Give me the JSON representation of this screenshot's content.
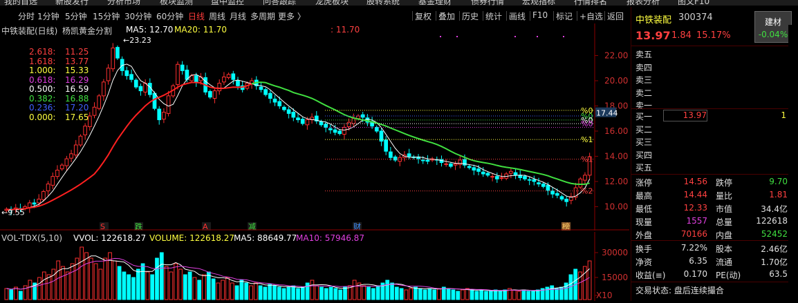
{
  "top_menu": [
    "我的首选",
    "新股发行",
    "分析市场",
    "板块监测",
    "盘中监控",
    "问答跟踪",
    "龙虎板块",
    "股转系统",
    "基金理财",
    "债券行情",
    "宏观指标",
    "行情排名",
    "报表分析",
    "图文F10"
  ],
  "toolbar": {
    "left": [
      "分时",
      "1分钟",
      "5分钟",
      "15分钟",
      "30分钟",
      "60分钟",
      "日线",
      "周线",
      "月线",
      "多周期",
      "更多 〉"
    ],
    "active": "日线",
    "right": [
      "复权",
      "叠加",
      "历史",
      "统计",
      "画线",
      "F10",
      "标记",
      "+自选",
      "返回"
    ]
  },
  "chart_header": {
    "title": "中铁装配(日线)",
    "indicator": "杨凯黄金分割",
    "ma5": "MA5: 12.70",
    "ma20": "MA20: 11.70",
    "ma_marker": ": 11.70"
  },
  "golden_ratios": [
    {
      "label": "2.618:",
      "value": "11.25",
      "color": "#ff4040"
    },
    {
      "label": "1.618:",
      "value": "13.77",
      "color": "#ff4040"
    },
    {
      "label": "1.000:",
      "value": "15.33",
      "color": "#ffff40"
    },
    {
      "label": "0.618:",
      "value": "16.29",
      "color": "#e040e0"
    },
    {
      "label": "0.500:",
      "value": "16.59",
      "color": "#ffffff"
    },
    {
      "label": "0.382:",
      "value": "16.88",
      "color": "#40e040"
    },
    {
      "label": "0.236:",
      "value": "17.20",
      "color": "#4060ff"
    },
    {
      "label": "0.000:",
      "value": "17.65",
      "color": "#ffff40"
    }
  ],
  "chart_data": {
    "type": "candlestick",
    "y_axis_ticks": [
      22.0,
      20.0,
      18.0,
      16.0,
      14.0,
      12.0,
      10.0
    ],
    "ylim": [
      9.2,
      24.0
    ],
    "max_label": "23.23",
    "min_label": "9.55",
    "current_price_tag": "17.44",
    "level_markers": [
      "%0",
      "%0",
      "%0",
      "%0",
      "%1",
      "%1",
      "%2"
    ],
    "event_markers": [
      "S",
      "跌",
      "A",
      "减",
      "财",
      "榜"
    ],
    "close_series": [
      9.8,
      9.7,
      9.9,
      9.8,
      10.0,
      10.3,
      10.2,
      10.6,
      11.2,
      11.8,
      12.4,
      12.9,
      13.3,
      13.8,
      14.2,
      14.9,
      15.6,
      16.4,
      17.2,
      17.9,
      18.8,
      19.9,
      21.0,
      22.6,
      21.8,
      20.8,
      20.4,
      20.1,
      19.5,
      19.2,
      19.8,
      18.9,
      17.8,
      16.9,
      17.5,
      18.8,
      19.6,
      21.3,
      20.8,
      20.1,
      20.4,
      19.9,
      20.3,
      19.1,
      18.7,
      19.2,
      19.8,
      20.3,
      20.5,
      20.1,
      19.6,
      19.3,
      19.8,
      20.0,
      19.6,
      19.3,
      18.9,
      18.6,
      18.3,
      18.0,
      17.7,
      17.4,
      17.1,
      16.9,
      16.6,
      16.9,
      17.1,
      16.8,
      16.5,
      16.3,
      16.1,
      15.9,
      15.8,
      16.3,
      16.7,
      17.0,
      17.2,
      17.1,
      16.7,
      16.4,
      16.0,
      15.2,
      14.4,
      13.9,
      13.7,
      13.9,
      14.1,
      14.0,
      13.9,
      13.8,
      13.7,
      13.6,
      13.8,
      13.7,
      13.5,
      13.4,
      13.2,
      13.4,
      13.7,
      13.3,
      13.1,
      12.9,
      12.8,
      12.6,
      12.5,
      12.4,
      12.2,
      12.3,
      12.6,
      12.8,
      12.5,
      12.3,
      12.2,
      12.1,
      12.0,
      11.8,
      11.6,
      11.3,
      11.0,
      10.9,
      10.6,
      10.4,
      10.8,
      11.5,
      12.2,
      12.5,
      13.97
    ]
  },
  "vol_header": {
    "name": "VOL-TDX(5,10)",
    "vvol": "VVOL: 122618.27",
    "volume": "VOLUME: 122618.27",
    "ma5": "MA5: 88649.77",
    "ma10": "MA10: 57946.87"
  },
  "vol_ticks": [
    "30000",
    "15000",
    "X10"
  ],
  "vol_data": [
    8,
    7,
    9,
    6,
    10,
    14,
    12,
    16,
    20,
    18,
    22,
    28,
    24,
    20,
    26,
    30,
    38,
    34,
    30,
    26,
    22,
    30,
    34,
    28,
    24,
    20,
    18,
    16,
    22,
    26,
    20,
    18,
    30,
    34,
    24,
    20,
    26,
    22,
    18,
    20,
    16,
    14,
    18,
    20,
    15,
    12,
    14,
    16,
    12,
    10,
    14,
    12,
    10,
    12,
    10,
    9,
    11,
    10,
    9,
    8,
    9,
    10,
    8,
    9,
    12,
    14,
    10,
    9,
    8,
    9,
    8,
    7,
    9,
    10,
    14,
    12,
    10,
    9,
    8,
    10,
    12,
    14,
    12,
    9,
    8,
    7,
    8,
    9,
    8,
    7,
    8,
    7,
    8,
    9,
    8,
    7,
    6,
    7,
    8,
    7,
    6,
    7,
    6,
    6,
    7,
    6,
    7,
    8,
    7,
    6,
    7,
    6,
    6,
    7,
    8,
    9,
    10,
    8,
    9,
    12,
    18,
    22,
    20,
    24,
    28
  ],
  "panel": {
    "stock_name": "中铁装配",
    "code": "300374",
    "price": "13.97",
    "change": "1.84",
    "pct": "15.17%",
    "sector": "建材",
    "sector_pct": "-0.04%",
    "asks": [
      "卖五",
      "卖四",
      "卖三",
      "卖二",
      "卖一"
    ],
    "bids": [
      {
        "label": "买一",
        "price": "13.97",
        "vol": "1"
      },
      {
        "label": "买二",
        "price": "",
        "vol": ""
      },
      {
        "label": "买三",
        "price": "",
        "vol": ""
      },
      {
        "label": "买四",
        "price": "",
        "vol": ""
      },
      {
        "label": "买五",
        "price": "",
        "vol": ""
      }
    ],
    "stats": [
      {
        "l1": "涨停",
        "v1": "14.56",
        "c1": "#ff4040",
        "l2": "跌停",
        "v2": "9.70",
        "c2": "#40e040"
      },
      {
        "l1": "最高",
        "v1": "14.44",
        "c1": "#ff4040",
        "l2": "量比",
        "v2": "1.81",
        "c2": "#ff4040"
      },
      {
        "l1": "最低",
        "v1": "12.33",
        "c1": "#ff4040",
        "l2": "市值",
        "v2": "34.4亿",
        "c2": "#e0e0e0"
      },
      {
        "l1": "现量",
        "v1": "1557",
        "c1": "#e040e0",
        "l2": "总量",
        "v2": "122618",
        "c2": "#e0e0e0"
      },
      {
        "l1": "外盘",
        "v1": "70166",
        "c1": "#ff4040",
        "l2": "内盘",
        "v2": "52452",
        "c2": "#40e040"
      }
    ],
    "stats2": [
      {
        "l1": "换手",
        "v1": "7.22%",
        "c1": "#e0e0e0",
        "l2": "股本",
        "v2": "2.46亿",
        "c2": "#e0e0e0"
      },
      {
        "l1": "净资",
        "v1": "6.35",
        "c1": "#e0e0e0",
        "l2": "流通",
        "v2": "1.70亿",
        "c2": "#e0e0e0"
      },
      {
        "l1": "收益(≡)",
        "v1": "0.170",
        "c1": "#e0e0e0",
        "l2": "PE(动)",
        "v2": "63.5",
        "c2": "#e0e0e0"
      }
    ],
    "trade_status": "交易状态: 盘后连续撮合"
  },
  "colors": {
    "up": "#ff3030",
    "down": "#00ffff",
    "ma5": "#ffffff",
    "ma20_red": "#ff2020",
    "ma_green": "#40e040"
  }
}
